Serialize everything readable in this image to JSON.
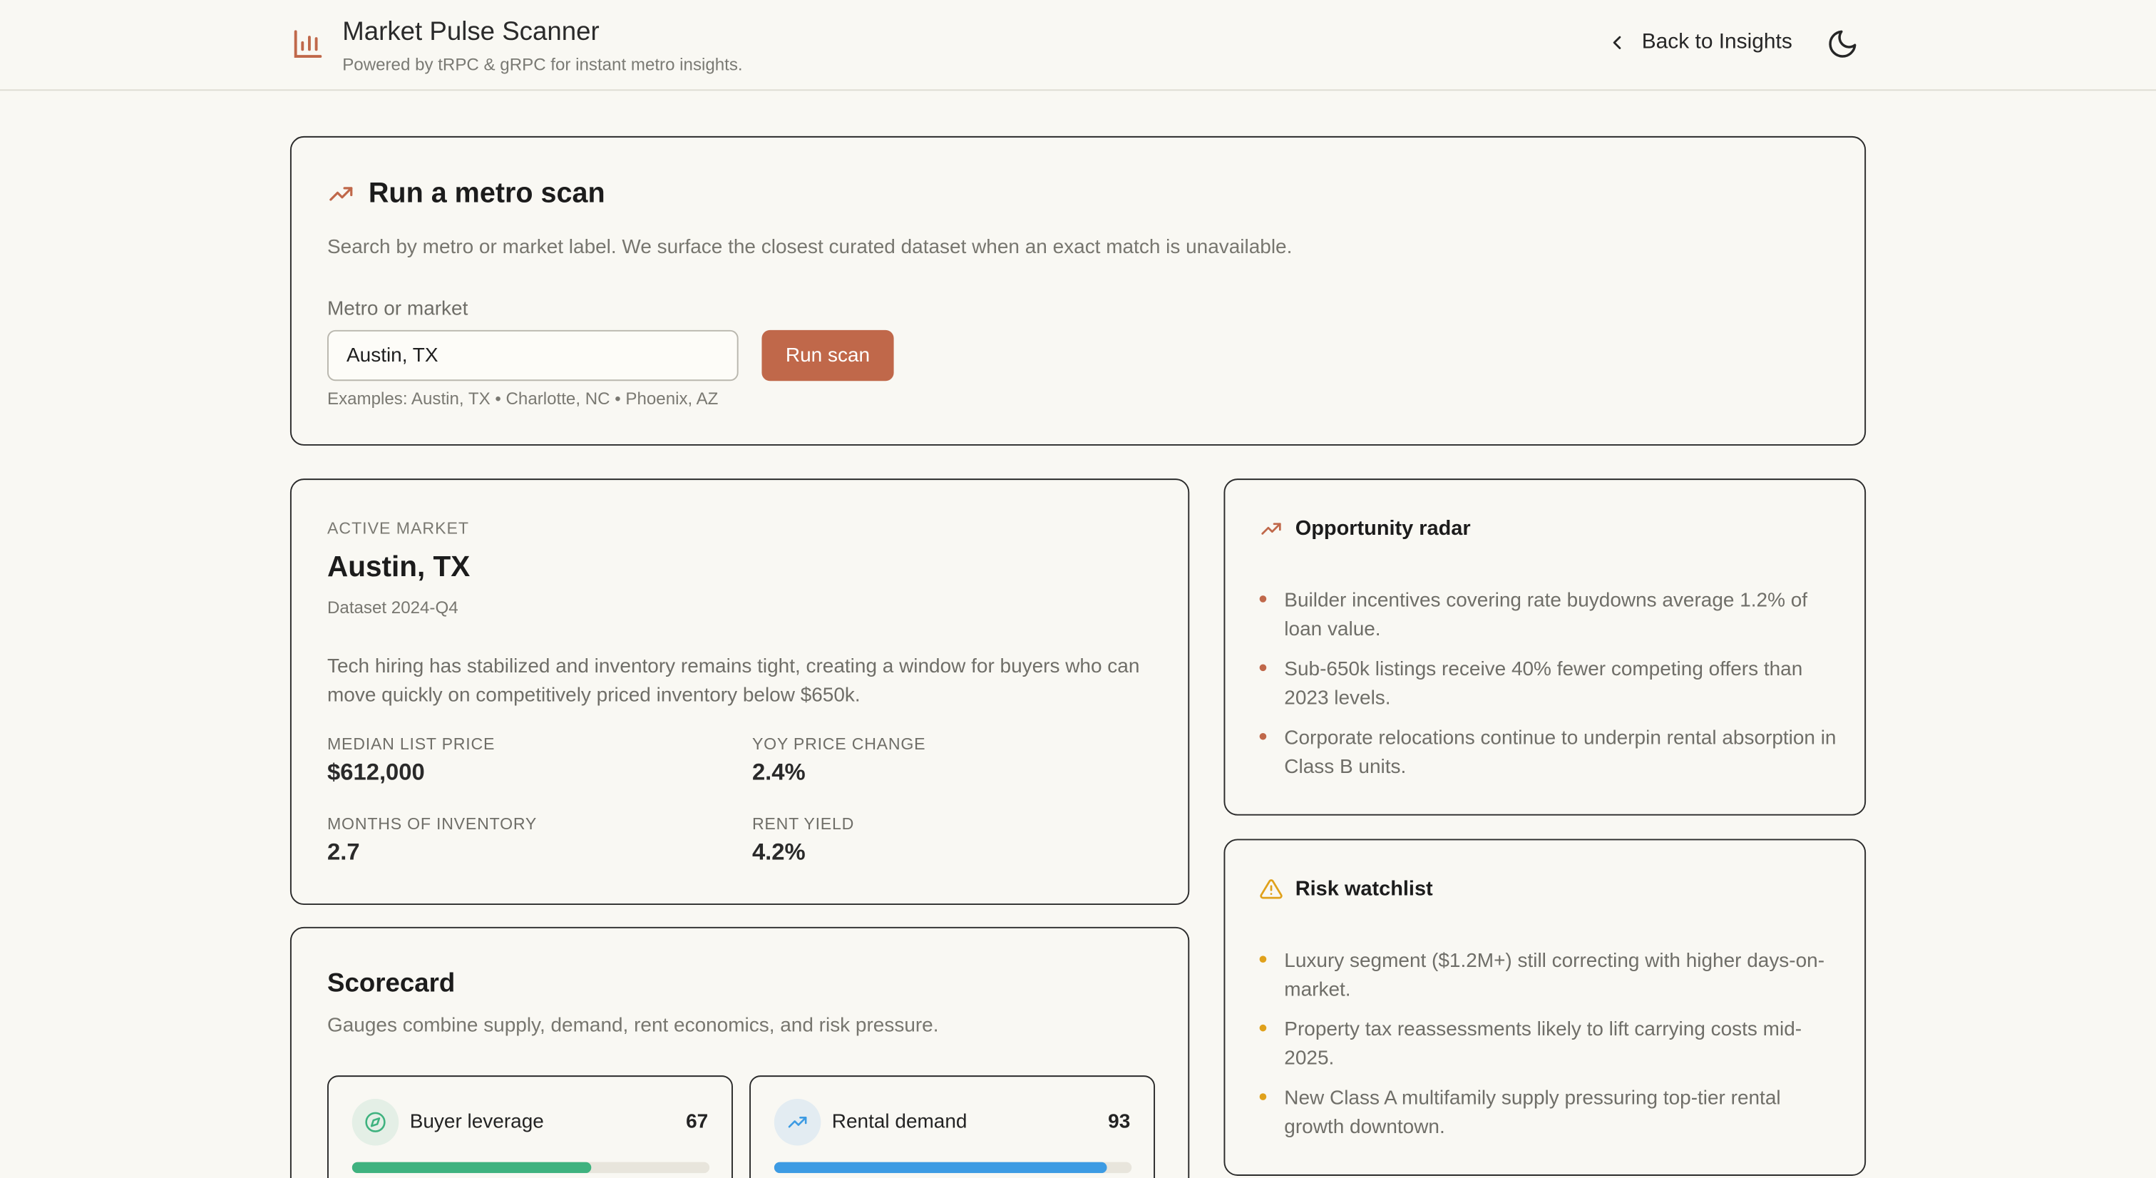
{
  "header": {
    "title": "Market Pulse Scanner",
    "subtitle": "Powered by tRPC & gRPC for instant metro insights.",
    "back_label": "Back to Insights",
    "brand_icon": "bar-chart-icon",
    "theme_icon": "moon-icon"
  },
  "scan": {
    "title": "Run a metro scan",
    "description": "Search by metro or market label. We surface the closest curated dataset when an exact match is unavailable.",
    "field_label": "Metro or market",
    "input_value": "Austin, TX",
    "button_label": "Run scan",
    "examples": "Examples: Austin, TX • Charlotte, NC • Phoenix, AZ"
  },
  "market": {
    "eyebrow": "ACTIVE MARKET",
    "name": "Austin, TX",
    "dataset": "Dataset 2024-Q4",
    "summary": "Tech hiring has stabilized and inventory remains tight, creating a window for buyers who can move quickly on competitively priced inventory below $650k.",
    "metrics": [
      {
        "label": "MEDIAN LIST PRICE",
        "value": "$612,000"
      },
      {
        "label": "YOY PRICE CHANGE",
        "value": "2.4%"
      },
      {
        "label": "MONTHS OF INVENTORY",
        "value": "2.7"
      },
      {
        "label": "RENT YIELD",
        "value": "4.2%"
      }
    ]
  },
  "scorecard": {
    "title": "Scorecard",
    "description": "Gauges combine supply, demand, rent economics, and risk pressure.",
    "gauges": [
      {
        "label": "Buyer leverage",
        "score": "67",
        "fraction": 0.67,
        "color": "#3fb27f",
        "icon_bg": "#e4efe6",
        "icon": "compass-icon"
      },
      {
        "label": "Rental demand",
        "score": "93",
        "fraction": 0.93,
        "color": "#3d9be3",
        "icon_bg": "#e3ecf2",
        "icon": "trending-up-icon"
      }
    ]
  },
  "opportunity": {
    "title": "Opportunity radar",
    "bullet_color": "#c0684a",
    "items": [
      "Builder incentives covering rate buydowns average 1.2% of loan value.",
      "Sub-650k listings receive 40% fewer competing offers than 2023 levels.",
      "Corporate relocations continue to underpin rental absorption in Class B units."
    ]
  },
  "risk": {
    "title": "Risk watchlist",
    "bullet_color": "#e0a11b",
    "items": [
      "Luxury segment ($1.2M+) still correcting with higher days-on-market.",
      "Property tax reassessments likely to lift carrying costs mid-2025.",
      "New Class A multifamily supply pressuring top-tier rental growth downtown."
    ]
  },
  "colors": {
    "accent": "#c0684a",
    "background": "#f9f8f3",
    "warning": "#e0a11b"
  }
}
